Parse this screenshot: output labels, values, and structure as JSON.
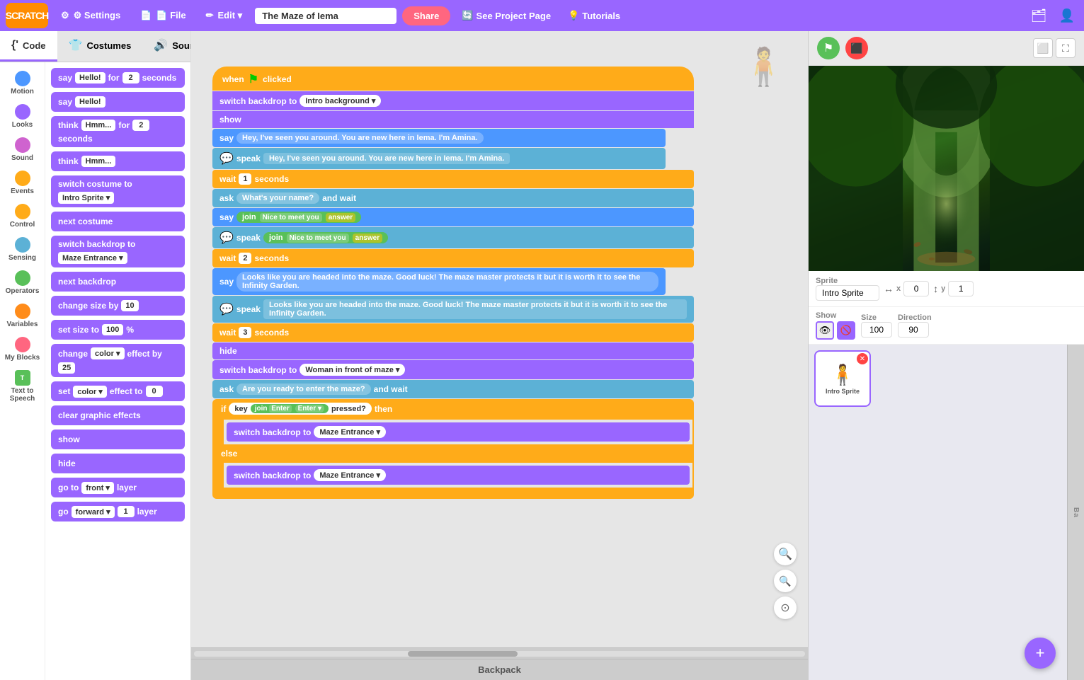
{
  "navbar": {
    "logo": "SCRATCH",
    "settings_label": "⚙ Settings",
    "file_label": "📄 File",
    "edit_label": "✏ Edit",
    "project_name": "The Maze of Iema",
    "share_label": "Share",
    "see_project_label": "See Project Page",
    "tutorials_label": "Tutorials"
  },
  "tabs": {
    "code": "Code",
    "costumes": "Costumes",
    "sounds": "Sounds"
  },
  "categories": [
    {
      "id": "motion",
      "label": "Motion",
      "color": "motion"
    },
    {
      "id": "looks",
      "label": "Looks",
      "color": "looks"
    },
    {
      "id": "sound",
      "label": "Sound",
      "color": "sound"
    },
    {
      "id": "events",
      "label": "Events",
      "color": "events"
    },
    {
      "id": "control",
      "label": "Control",
      "color": "control"
    },
    {
      "id": "sensing",
      "label": "Sensing",
      "color": "sensing"
    },
    {
      "id": "operators",
      "label": "Operators",
      "color": "operators"
    },
    {
      "id": "variables",
      "label": "Variables",
      "color": "variables"
    },
    {
      "id": "myblocks",
      "label": "My Blocks",
      "color": "myblocks"
    },
    {
      "id": "text",
      "label": "Text to Speech",
      "color": "text"
    }
  ],
  "blocks": [
    {
      "type": "purple",
      "text": "say",
      "input": "Hello!",
      "extra": "for",
      "input2": "2",
      "extra2": "seconds"
    },
    {
      "type": "purple",
      "text": "say",
      "input": "Hello!"
    },
    {
      "type": "purple",
      "text": "think",
      "input": "Hmm...",
      "extra": "for",
      "input2": "2",
      "extra2": "seconds"
    },
    {
      "type": "purple",
      "text": "think",
      "input": "Hmm..."
    },
    {
      "type": "purple",
      "text": "switch costume to",
      "dropdown": "Intro Sprite"
    },
    {
      "type": "purple",
      "text": "next costume"
    },
    {
      "type": "purple",
      "text": "switch backdrop to",
      "dropdown": "Maze Entrance"
    },
    {
      "type": "purple",
      "text": "next backdrop"
    },
    {
      "type": "purple",
      "text": "change size by",
      "input": "10"
    },
    {
      "type": "purple",
      "text": "set size to",
      "input": "100",
      "extra": "%"
    },
    {
      "type": "purple",
      "text": "change",
      "dropdown": "color",
      "extra": "effect by",
      "input": "25"
    },
    {
      "type": "purple",
      "text": "set",
      "dropdown": "color",
      "extra": "effect to",
      "input": "0"
    },
    {
      "type": "purple",
      "text": "clear graphic effects"
    },
    {
      "type": "purple",
      "text": "show"
    },
    {
      "type": "purple",
      "text": "hide"
    },
    {
      "type": "purple",
      "text": "go to",
      "dropdown": "front",
      "extra": "▾ layer"
    },
    {
      "type": "purple",
      "text": "go",
      "dropdown": "forward",
      "extra": "▾",
      "input": "1",
      "extra2": "layer"
    }
  ],
  "canvas_blocks": {
    "hat": "when 🚩 clicked",
    "blocks": [
      {
        "type": "purple",
        "text": "switch backdrop to",
        "dropdown": "Intro background"
      },
      {
        "type": "purple",
        "text": "show"
      },
      {
        "type": "blue",
        "text": "say",
        "str": "Hey, I've seen you around. You are new here in Iema. I'm Amina."
      },
      {
        "type": "teal",
        "kind": "speak",
        "str": "Hey, I've seen you around. You are new here in Iema. I'm Amina."
      },
      {
        "type": "orange",
        "text": "wait",
        "input": "1",
        "extra": "seconds"
      },
      {
        "type": "teal",
        "kind": "ask",
        "str": "What's your name?",
        "extra": "and wait"
      },
      {
        "type": "blue",
        "text": "say",
        "join": true,
        "str1": "Nice to meet you",
        "str2": "answer"
      },
      {
        "type": "teal",
        "kind": "speak",
        "join": true,
        "str1": "Nice to meet you",
        "str2": "answer"
      },
      {
        "type": "orange",
        "text": "wait",
        "input": "2",
        "extra": "seconds"
      },
      {
        "type": "blue",
        "text": "say",
        "str": "Looks like you are headed into the maze. Good luck! The maze master protects it but it is worth it to see the Infinity Garden."
      },
      {
        "type": "teal",
        "kind": "speak",
        "str": "Looks like you are headed into the maze. Good luck! The maze master protects it but it is worth it to see the Infinity Garden."
      },
      {
        "type": "orange",
        "text": "wait",
        "input": "3",
        "extra": "seconds"
      },
      {
        "type": "purple",
        "text": "hide"
      },
      {
        "type": "purple",
        "text": "switch backdrop to",
        "dropdown": "Woman in front of maze"
      },
      {
        "type": "teal",
        "kind": "ask",
        "str": "Are you ready to enter the maze?",
        "extra": "and wait"
      },
      {
        "type": "c_if",
        "condition": "key join Enter ▾ Enter ▾ pressed?",
        "then_blocks": [
          {
            "type": "purple",
            "text": "switch backdrop to",
            "dropdown": "Maze Entrance"
          }
        ],
        "else_blocks": [
          {
            "type": "purple",
            "text": "switch backdrop to",
            "dropdown": "Maze Entrance"
          }
        ]
      }
    ]
  },
  "sprite_panel": {
    "sprite_label": "Sprite",
    "sprite_name": "Intro Sprite",
    "x_label": "x",
    "x_value": "0",
    "y_label": "y",
    "y_value": "1",
    "show_label": "Show",
    "size_label": "Size",
    "size_value": "100",
    "direction_label": "Direction",
    "direction_value": "90"
  },
  "sprites": [
    {
      "name": "Intro Sprite",
      "selected": true
    }
  ],
  "backpack_label": "Backpack",
  "zoom_in_title": "Zoom in",
  "zoom_out_title": "Zoom out",
  "zoom_reset_title": "Reset zoom"
}
